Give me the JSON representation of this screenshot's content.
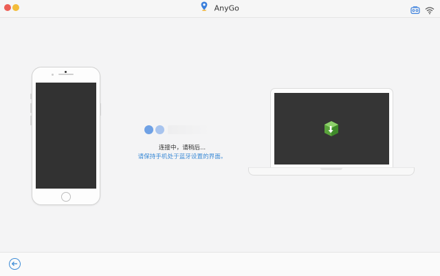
{
  "window": {
    "title": "AnyGo"
  },
  "titlebar_icons": {
    "device": "device-icon",
    "wifi": "wifi-icon"
  },
  "connection": {
    "status": "连接中，请稍后...",
    "hint": "请保持手机处于蓝牙设置的界面。"
  },
  "colors": {
    "accent": "#3d8bd6",
    "dot_primary": "#6fa1e5",
    "dot_secondary": "#a8c4ee"
  }
}
